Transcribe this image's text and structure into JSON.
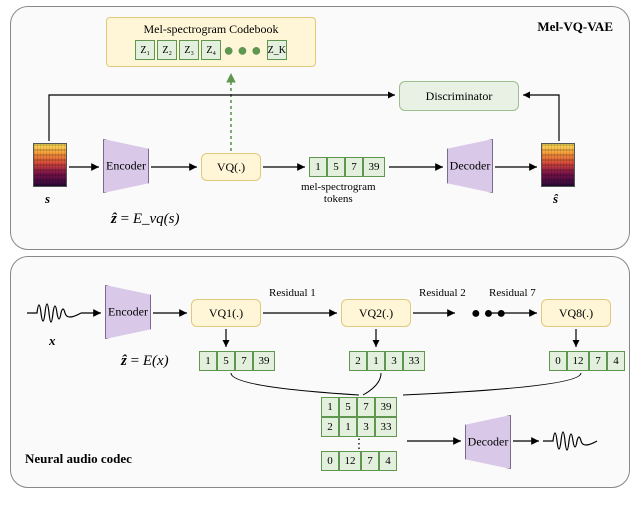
{
  "panels": {
    "top_title": "Mel-VQ-VAE",
    "bottom_title": "Neural audio codec"
  },
  "top": {
    "codebook_title": "Mel-spectrogram Codebook",
    "codebook_entries": [
      "Z₁",
      "Z₂",
      "Z₃",
      "Z₄",
      "Z_K"
    ],
    "encoder": "Encoder",
    "decoder": "Decoder",
    "vq": "VQ(.)",
    "discriminator": "Discriminator",
    "input_symbol": "s",
    "output_symbol": "ŝ",
    "tokens_label": "mel-spectrogram\ntokens",
    "tokens": [
      "1",
      "5",
      "7",
      "39"
    ],
    "eq_lhs": "ẑ",
    "eq_eq": " = ",
    "eq_rhs": "E_vq(s)"
  },
  "bottom": {
    "encoder": "Encoder",
    "decoder": "Decoder",
    "vq_blocks": [
      "VQ1(.)",
      "VQ2(.)",
      "VQ8(.)"
    ],
    "residual_labels": [
      "Residual 1",
      "Residual 2",
      "Residual 7"
    ],
    "input_symbol": "x",
    "eq_lhs": "ẑ",
    "eq_eq": " = ",
    "eq_rhs": "E(x)",
    "tokens_vq1": [
      "1",
      "5",
      "7",
      "39"
    ],
    "tokens_vq2": [
      "2",
      "1",
      "3",
      "33"
    ],
    "tokens_vq8": [
      "0",
      "12",
      "7",
      "4"
    ],
    "stack": [
      [
        "1",
        "5",
        "7",
        "39"
      ],
      [
        "2",
        "1",
        "3",
        "33"
      ],
      [
        "0",
        "12",
        "7",
        "4"
      ]
    ]
  },
  "chart_data": {
    "type": "diagram",
    "title": "Two neural audio tokenisation pipelines",
    "panels": [
      {
        "name": "Mel-VQ-VAE",
        "flow": [
          "s (mel-spectrogram)",
          "Encoder",
          "VQ(.)",
          "token sequence",
          "Decoder",
          "ŝ (reconstructed mel-spectrogram)"
        ],
        "aux": [
          "Discriminator receives s and ŝ",
          "Codebook {Z_1..Z_K} used by VQ"
        ],
        "equation": "ẑ = E_vq(s)",
        "example_tokens": [
          1,
          5,
          7,
          39
        ]
      },
      {
        "name": "Neural audio codec (residual VQ, 8 stages)",
        "flow": [
          "x (waveform)",
          "Encoder",
          "VQ1(.)",
          "Residual 1",
          "VQ2(.)",
          "Residual 2",
          "…",
          "Residual 7",
          "VQ8(.)",
          "stacked tokens",
          "Decoder",
          "waveform"
        ],
        "equation": "ẑ = E(x)",
        "num_vq_stages": 8,
        "example_token_rows": [
          [
            1,
            5,
            7,
            39
          ],
          [
            2,
            1,
            3,
            33
          ],
          "…",
          [
            0,
            12,
            7,
            4
          ]
        ]
      }
    ]
  }
}
